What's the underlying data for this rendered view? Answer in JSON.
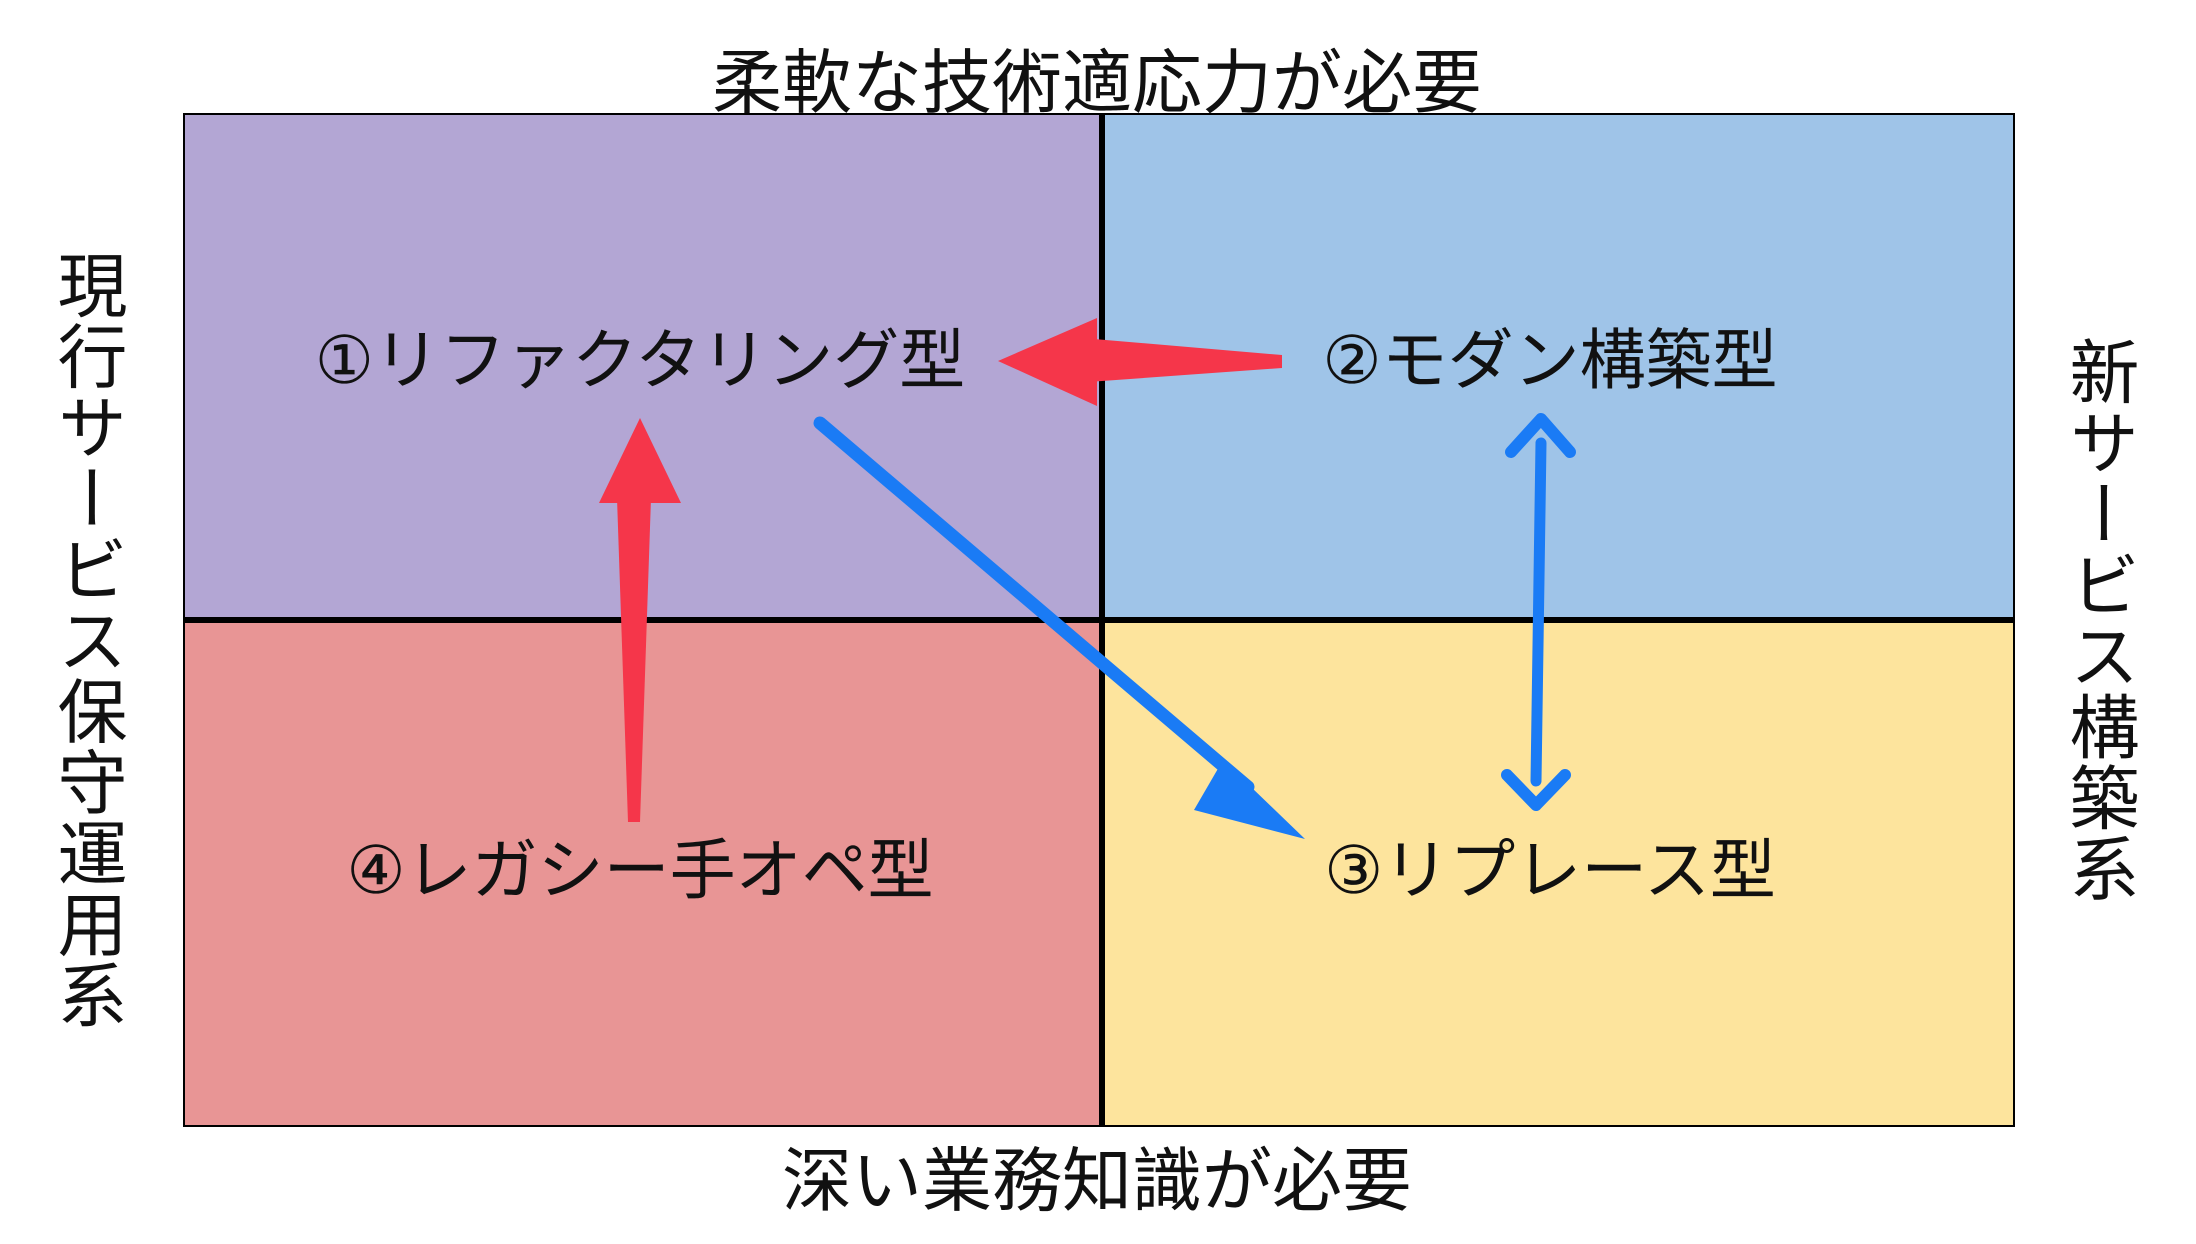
{
  "axes": {
    "top": "柔軟な技術適応力が必要",
    "bottom": "深い業務知識が必要",
    "left": "現行サービス保守運用系",
    "right": "新サービス構築系"
  },
  "quadrants": [
    {
      "id": "1",
      "label": "①リファクタリング型",
      "color": "#B3A6D4"
    },
    {
      "id": "2",
      "label": "②モダン構築型",
      "color": "#9FC4E8"
    },
    {
      "id": "3",
      "label": "③リプレース型",
      "color": "#FDE49D"
    },
    {
      "id": "4",
      "label": "④レガシー手オペ型",
      "color": "#E89595"
    }
  ],
  "arrows": [
    {
      "from": "2",
      "to": "1",
      "color": "#F5364A",
      "style": "single"
    },
    {
      "from": "4",
      "to": "1",
      "color": "#F5364A",
      "style": "single"
    },
    {
      "from": "1",
      "to": "3",
      "color": "#1A7BF5",
      "style": "single"
    },
    {
      "from": "2",
      "to": "3",
      "color": "#1A7BF5",
      "style": "double"
    }
  ]
}
